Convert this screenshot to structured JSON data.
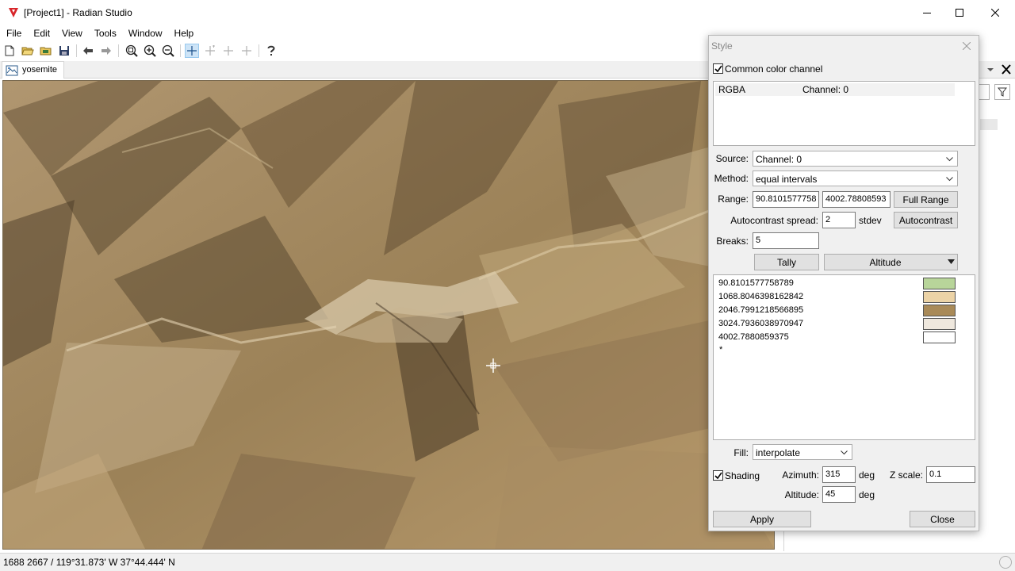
{
  "window": {
    "title": "[Project1] - Radian Studio"
  },
  "menu": [
    "File",
    "Edit",
    "View",
    "Tools",
    "Window",
    "Help"
  ],
  "tabs": [
    {
      "label": "yosemite"
    }
  ],
  "status": {
    "text": "1688 2667 / 119°31.873' W 37°44.444' N"
  },
  "style_dialog": {
    "title": "Style",
    "common_channel": {
      "label": "Common color channel",
      "checked": true
    },
    "channels": {
      "type": "RGBA",
      "channel": "Channel: 0"
    },
    "source": {
      "label": "Source:",
      "value": "Channel: 0"
    },
    "method": {
      "label": "Method:",
      "value": "equal intervals"
    },
    "range": {
      "label": "Range:",
      "min": "90.8101577758",
      "max": "4002.78808593",
      "button": "Full Range"
    },
    "autocontrast": {
      "label": "Autocontrast spread:",
      "value": "2",
      "unit": "stdev",
      "button": "Autocontrast"
    },
    "breaks": {
      "label": "Breaks:",
      "value": "5"
    },
    "tally_button": "Tally",
    "palette_button": "Altitude",
    "break_rows": [
      {
        "value": "90.8101577758789",
        "color": "#b8d59a"
      },
      {
        "value": "1068.8046398162842",
        "color": "#ecd3a6"
      },
      {
        "value": "2046.7991218566895",
        "color": "#a98a58"
      },
      {
        "value": "3024.7936038970947",
        "color": "#efe8de"
      },
      {
        "value": "4002.7880859375",
        "color": "#ffffff"
      }
    ],
    "break_new_marker": "*",
    "fill": {
      "label": "Fill:",
      "value": "interpolate"
    },
    "shading": {
      "label": "Shading",
      "checked": true,
      "azimuth_label": "Azimuth:",
      "azimuth": "315",
      "azimuth_unit": "deg",
      "altitude_label": "Altitude:",
      "altitude": "45",
      "altitude_unit": "deg",
      "zscale_label": "Z scale:",
      "zscale": "0.1"
    },
    "apply_button": "Apply",
    "close_button": "Close"
  }
}
